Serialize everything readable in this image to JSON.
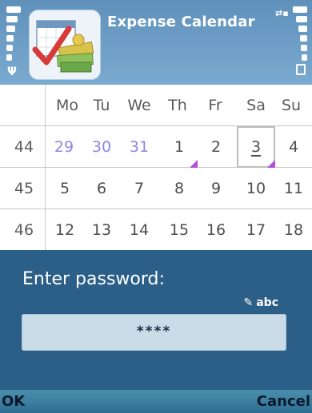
{
  "header": {
    "title": "Expense Calendar",
    "app_icon": "expense-calendar-icon"
  },
  "calendar": {
    "weekday_headers": [
      "Mo",
      "Tu",
      "We",
      "Th",
      "Fr",
      "Sa",
      "Su"
    ],
    "weeks": [
      {
        "number": "44",
        "days": [
          "29",
          "30",
          "31",
          "1",
          "2",
          "3",
          "4"
        ]
      },
      {
        "number": "45",
        "days": [
          "5",
          "6",
          "7",
          "8",
          "9",
          "10",
          "11"
        ]
      },
      {
        "number": "46",
        "days": [
          "12",
          "13",
          "14",
          "15",
          "16",
          "17",
          "18"
        ]
      }
    ],
    "selected_day": "3",
    "marked_days": [
      "1",
      "3"
    ],
    "colors": {
      "other_month": "#8f85e6",
      "marker": "#b14fd6"
    }
  },
  "dialog": {
    "prompt": "Enter password:",
    "input_mode": "abc",
    "password_value": "****"
  },
  "softkeys": {
    "left": "OK",
    "right": "Cancel"
  }
}
